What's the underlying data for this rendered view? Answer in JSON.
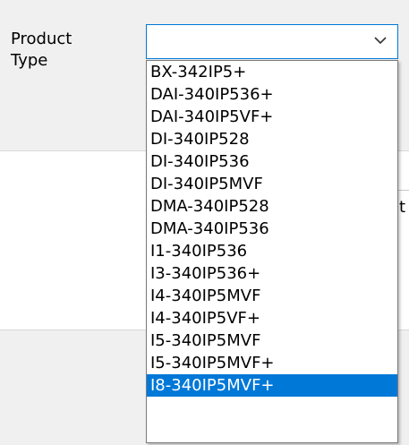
{
  "form": {
    "label": "Product\nType",
    "combo_value": "",
    "dropdown_icon": "chevron-down-icon",
    "background_glyph": "t"
  },
  "dropdown": {
    "selected_index": 14,
    "items": [
      "BX-342IP5+",
      "DAI-340IP536+",
      "DAI-340IP5VF+",
      "DI-340IP528",
      "DI-340IP536",
      "DI-340IP5MVF",
      "DMA-340IP528",
      "DMA-340IP536",
      "I1-340IP536",
      "I3-340IP536+",
      "I4-340IP5MVF",
      "I4-340IP5VF+",
      "I5-340IP5MVF",
      "I5-340IP5MVF+",
      "I8-340IP5MVF+"
    ]
  },
  "colors": {
    "selection": "#0078d7",
    "focus_border": "#0078d7",
    "list_border": "#7a7a7a",
    "background": "#f0f0f0"
  }
}
